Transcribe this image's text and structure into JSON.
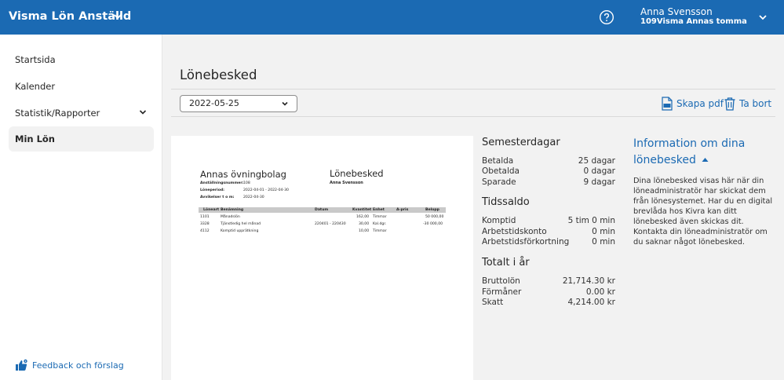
{
  "header": {
    "app_title": "Visma Lön Anställd",
    "user_name": "Anna Svensson",
    "user_org": "109Visma Annas tomma"
  },
  "sidebar": {
    "items": [
      {
        "label": "Startsida"
      },
      {
        "label": "Kalender"
      },
      {
        "label": "Statistik/Rapporter"
      },
      {
        "label": "Min Lön"
      }
    ],
    "feedback_label": "Feedback och förslag"
  },
  "main": {
    "title": "Lönebesked",
    "selected_date": "2022-05-25",
    "create_pdf_label": "Skapa pdf",
    "delete_label": "Ta bort"
  },
  "payslip": {
    "company": "Annas övningbolag",
    "title": "Lönebesked",
    "employee": "Anna Svensson",
    "meta": [
      {
        "label": "Anställningsnummer:",
        "value": "108"
      },
      {
        "label": "Löneperiod:",
        "value": "2022-04-01 - 2022-04-30"
      },
      {
        "label": "Avvikelser t o m:",
        "value": "2022-04-30"
      }
    ],
    "columns": [
      "Löneart",
      "Benämning",
      "Datum",
      "Kvantitet",
      "Enhet",
      "A-pris",
      "Belopp"
    ],
    "rows": [
      {
        "code": "1101",
        "name": "Månadslön",
        "date": "",
        "qty": "162,00",
        "unit": "Timmar",
        "price": "",
        "amount": "50 000,00"
      },
      {
        "code": "3328",
        "name": "Tjänstledig hel månad",
        "date": "220401 - 220430",
        "qty": "30,00",
        "unit": "Kal.dgr.",
        "price": "",
        "amount": "-30 000,00"
      },
      {
        "code": "4112",
        "name": "Komptid upprätkning",
        "date": "",
        "qty": "10,00",
        "unit": "Timmar",
        "price": "",
        "amount": ""
      }
    ]
  },
  "summary": {
    "vacation": {
      "title": "Semesterdagar",
      "rows": [
        {
          "label": "Betalda",
          "value": "25 dagar"
        },
        {
          "label": "Obetalda",
          "value": "0 dagar"
        },
        {
          "label": "Sparade",
          "value": "9 dagar"
        }
      ]
    },
    "time_balance": {
      "title": "Tidssaldo",
      "rows": [
        {
          "label": "Komptid",
          "value": "5 tim 0 min"
        },
        {
          "label": "Arbetstidskonto",
          "value": "0 min"
        },
        {
          "label": "Arbetstidsförkortning",
          "value": "0 min"
        }
      ]
    },
    "year_total": {
      "title": "Totalt i år",
      "rows": [
        {
          "label": "Bruttolön",
          "value": "21,714.30 kr"
        },
        {
          "label": "Förmåner",
          "value": "0.00 kr"
        },
        {
          "label": "Skatt",
          "value": "4,214.00 kr"
        }
      ]
    }
  },
  "info": {
    "title": "Information om dina lönebesked",
    "text": "Dina lönebesked visas här när din löneadministratör har skickat dem från lönesystemet. Har du en digital brevlåda hos Kivra kan ditt lönebesked även skickas dit. Kontakta din löneadministratör om du saknar något lönebesked."
  },
  "colors": {
    "brand": "#1b6ab3",
    "sidebar_active": "#f2f2f2"
  }
}
